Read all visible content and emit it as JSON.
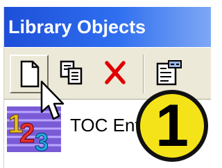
{
  "panel": {
    "title": "Library Objects"
  },
  "toolbar": {
    "buttons": [
      {
        "icon": "new-document-icon",
        "interactable": true
      },
      {
        "icon": "copy-icon",
        "interactable": true
      },
      {
        "icon": "delete-icon",
        "interactable": true
      },
      {
        "icon": "properties-icon",
        "interactable": true
      }
    ]
  },
  "list": {
    "items": [
      {
        "label": "TOC Ent",
        "icon": "numbering-icon"
      }
    ]
  },
  "badge": {
    "label": "1"
  },
  "colors": {
    "title_bar": "#2f6ff0",
    "badge": "#f5e31a",
    "delete_icon": "#e00000"
  }
}
